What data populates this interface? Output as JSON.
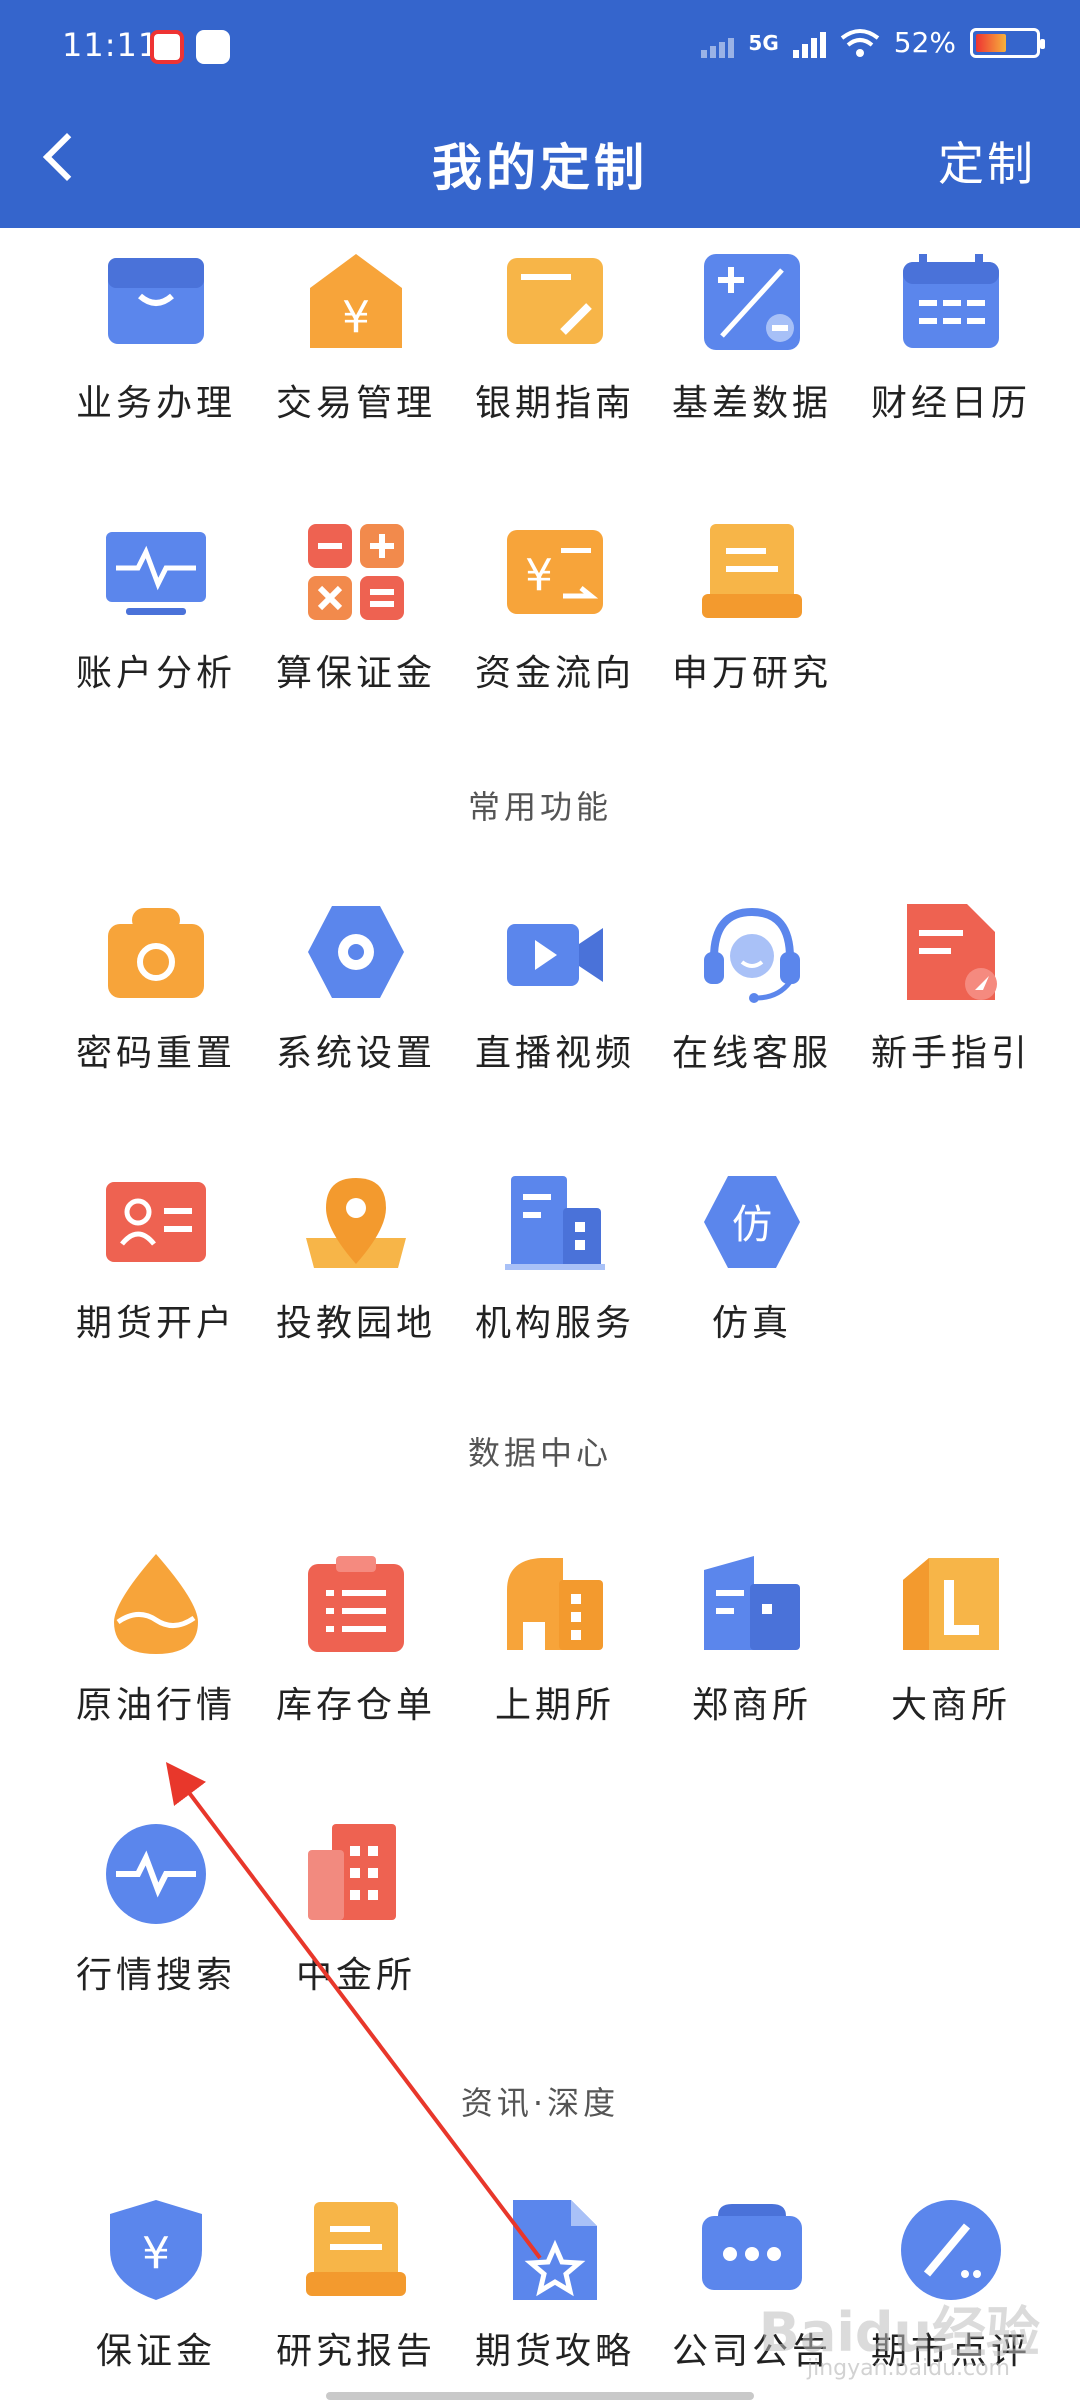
{
  "status": {
    "time": "11:11",
    "network": "5G",
    "battery": "52%"
  },
  "header": {
    "title": "我的定制",
    "action": "定制"
  },
  "groups": [
    {
      "title": "",
      "items": [
        "业务办理",
        "交易管理",
        "银期指南",
        "基差数据",
        "财经日历",
        "账户分析",
        "算保证金",
        "资金流向",
        "申万研究"
      ]
    },
    {
      "title": "常用功能",
      "items": [
        "密码重置",
        "系统设置",
        "直播视频",
        "在线客服",
        "新手指引",
        "期货开户",
        "投教园地",
        "机构服务",
        "仿真"
      ]
    },
    {
      "title": "数据中心",
      "items": [
        "原油行情",
        "库存仓单",
        "上期所",
        "郑商所",
        "大商所",
        "行情搜索",
        "中金所"
      ]
    },
    {
      "title": "资讯·深度",
      "items": [
        "保证金",
        "研究报告",
        "期货攻略",
        "公司公告",
        "期市点评"
      ]
    }
  ],
  "icons": {
    "g0": [
      "briefcase-icon",
      "yen-house-icon",
      "card-pen-icon",
      "plus-minus-icon",
      "calendar-icon",
      "monitor-pulse-icon",
      "calculator-icon",
      "yen-transfer-icon",
      "document-stack-icon"
    ],
    "g1": [
      "camera-reset-icon",
      "gear-hexagon-icon",
      "video-camera-icon",
      "headset-icon",
      "guide-document-icon",
      "id-card-icon",
      "map-pin-icon",
      "building-icon",
      "simulation-hexagon-icon"
    ],
    "g2": [
      "oil-drop-icon",
      "clipboard-list-icon",
      "factory-icon",
      "office-building-icon",
      "l-block-icon",
      "pulse-circle-icon",
      "red-building-icon"
    ],
    "g3": [
      "yen-shield-icon",
      "report-stack-icon",
      "star-document-icon",
      "message-dots-icon",
      "pen-circle-icon"
    ]
  },
  "sim_glyph": "仿",
  "watermark": {
    "brand": "Baidu经验",
    "url": "jingyan.baidu.com"
  },
  "colors": {
    "header": "#3565cc",
    "blue": "#4f79e6",
    "orange": "#f6a236",
    "red": "#ea5a4e"
  }
}
